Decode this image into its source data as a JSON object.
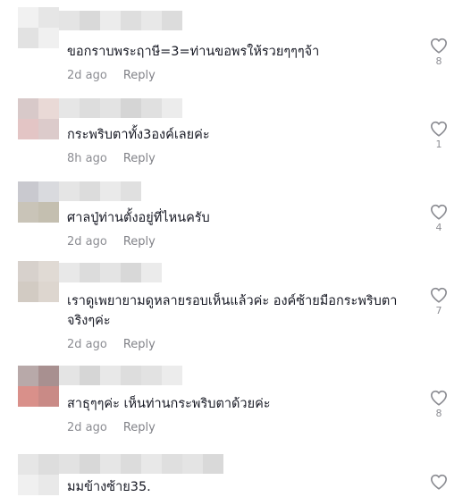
{
  "comments": [
    {
      "text": "ขอกราบพระฤาษี=3=ท่านขอพรให้รวยๆๆๆจ้า",
      "time": "2d ago",
      "reply_label": "Reply",
      "likes": "8",
      "avatar_pixels": [
        "#f1f1f1",
        "#e6e6e6",
        "#e2e2e2",
        "#f0f0f0"
      ],
      "name_pixels": [
        "#e4e4e4",
        "#d9d9d9",
        "#ececec",
        "#dedede",
        "#e8e8e8",
        "#dcdcdc"
      ]
    },
    {
      "text": "กระพริบตาทั้ง3องค์เลยค่ะ",
      "time": "8h ago",
      "reply_label": "Reply",
      "likes": "1",
      "avatar_pixels": [
        "#d8c9c9",
        "#e9d9d6",
        "#e3c5c5",
        "#dccbcb"
      ],
      "name_pixels": [
        "#e6e6e6",
        "#dddddd",
        "#e3e3e3",
        "#d5d5d5",
        "#e0e0e0",
        "#ececec"
      ]
    },
    {
      "text": "ศาลปู่ท่านตั้งอยู่ที่ไหนครับ",
      "time": "2d ago",
      "reply_label": "Reply",
      "likes": "4",
      "avatar_pixels": [
        "#c9c9cf",
        "#d9dade",
        "#c9c4b8",
        "#c4bfb0"
      ],
      "name_pixels": [
        "#e5e5e5",
        "#dcdcdc",
        "#eaeaea",
        "#e0e0e0"
      ]
    },
    {
      "text": "เราดูเพยายามดูหลายรอบเห็นแล้วค่ะ องค์ซ้ายมือกระพริบตา\nจริงๆค่ะ",
      "time": "2d ago",
      "reply_label": "Reply",
      "likes": "7",
      "avatar_pixels": [
        "#d7d1cc",
        "#e0dad4",
        "#d2cbc3",
        "#ddd6cf"
      ],
      "name_pixels": [
        "#e8e8e8",
        "#dcdcdc",
        "#e4e4e4",
        "#d8d8d8",
        "#ebebeb"
      ]
    },
    {
      "text": "สาธุๆๆค่ะ เห็นท่านกระพริบตาด้วยค่ะ",
      "time": "2d ago",
      "reply_label": "Reply",
      "likes": "8",
      "avatar_pixels": [
        "#b8a9a9",
        "#a89090",
        "#d9908a",
        "#c98a86"
      ],
      "name_pixels": [
        "#e4e4e4",
        "#d6d6d6",
        "#e8e8e8",
        "#dddddd",
        "#e2e2e2",
        "#ececec"
      ]
    },
    {
      "text": "มมข้างซ้าย35.",
      "time": "",
      "reply_label": "",
      "likes": "",
      "avatar_pixels": [
        "#e6e6e6",
        "#dddddd",
        "#f0f0f0",
        "#e9e9e9"
      ],
      "name_pixels": [
        "#e2e2e2",
        "#d8d8d8",
        "#e6e6e6",
        "#dcdcdc",
        "#e8e8e8",
        "#dfdfdf",
        "#e4e4e4",
        "#d9d9d9"
      ]
    }
  ]
}
